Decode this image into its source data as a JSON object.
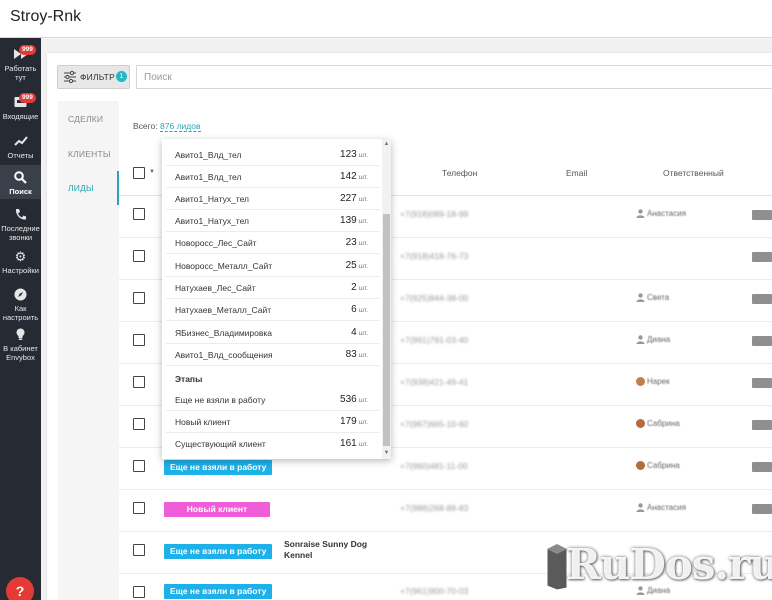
{
  "app": {
    "title": "Stroy-Rnk"
  },
  "sidebar": {
    "items": [
      {
        "label": "Работать тут",
        "icon": "fast-forward-icon",
        "badge": "999"
      },
      {
        "label": "Входящие",
        "icon": "inbox-icon",
        "badge": "999"
      },
      {
        "label": "Отчеты",
        "icon": "chart-icon"
      },
      {
        "label": "Поиск",
        "icon": "search-icon"
      },
      {
        "label": "Последние звонки",
        "icon": "phone-icon"
      },
      {
        "label": "Настройки",
        "icon": "gear-icon"
      },
      {
        "label": "Как настроить",
        "icon": "compass-icon"
      },
      {
        "label": "В кабинет Envybox",
        "icon": "lightbulb-icon"
      }
    ],
    "help_label": "?"
  },
  "toolbar": {
    "filter_label": "ФИЛЬТР",
    "filter_count": "1",
    "search_placeholder": "Поиск"
  },
  "tabs": [
    "СДЕЛКИ",
    "КЛИЕНТЫ",
    "ЛИДЫ"
  ],
  "total": {
    "prefix": "Всего:",
    "count": "876 лидов"
  },
  "table": {
    "headers": {
      "phone": "Телефон",
      "email": "Email",
      "responsible": "Ответственный"
    },
    "rows": [
      {
        "phone": "+7(918)089-18-99",
        "responsible": "Анастасия"
      },
      {
        "phone": "+7(918)418-76-73",
        "responsible": ""
      },
      {
        "phone": "+7(925)844-38-00",
        "responsible": "Света"
      },
      {
        "phone": "+7(991)791-03-40",
        "responsible": "Диана"
      },
      {
        "phone": "+7(938)421-49-41",
        "responsible": "Нарек"
      },
      {
        "phone": "+7(967)665-10-60",
        "responsible": "Сабрина"
      },
      {
        "stage": "Еще не взяли в работу",
        "phone": "+7(960)481-11-00",
        "responsible": "Сабрина"
      },
      {
        "stage": "Новый клиент",
        "phone": "+7(988)268-88-83",
        "responsible": "Анастасия"
      },
      {
        "stage": "Еще не взяли в работу",
        "name": "Sonraise Sunny Dog Kennel",
        "phone": "",
        "responsible": ""
      },
      {
        "stage": "Еще не взяли в работу",
        "phone": "+7(961)900-70-03",
        "responsible": "Диана"
      }
    ]
  },
  "dropdown": {
    "unit": "шт.",
    "sources": [
      {
        "name": "Авито1_Влд_тел",
        "count": "123"
      },
      {
        "name": "Авито1_Влд_тел",
        "count": "142"
      },
      {
        "name": "Авито1_Натух_тел",
        "count": "227"
      },
      {
        "name": "Авито1_Натух_тел",
        "count": "139"
      },
      {
        "name": "Новоросс_Лес_Сайт",
        "count": "23"
      },
      {
        "name": "Новоросс_Металл_Сайт",
        "count": "25"
      },
      {
        "name": "Натухаев_Лес_Сайт",
        "count": "2"
      },
      {
        "name": "Натухаев_Металл_Сайт",
        "count": "6"
      },
      {
        "name": "ЯБизнес_Владимировка",
        "count": "4"
      },
      {
        "name": "Авито1_Влд_сообщения",
        "count": "83"
      }
    ],
    "stages_title": "Этапы",
    "stages": [
      {
        "name": "Еще не взяли в работу",
        "count": "536"
      },
      {
        "name": "Новый клиент",
        "count": "179"
      },
      {
        "name": "Существующий клиент",
        "count": "161"
      }
    ]
  },
  "watermark": {
    "text": "RuDos.ru"
  },
  "colors": {
    "accent": "#26a7b5",
    "sidebar": "#262b33",
    "badge": "#e53935",
    "stage_new": "#f05dd8",
    "stage_wait": "#1eb0e8"
  }
}
